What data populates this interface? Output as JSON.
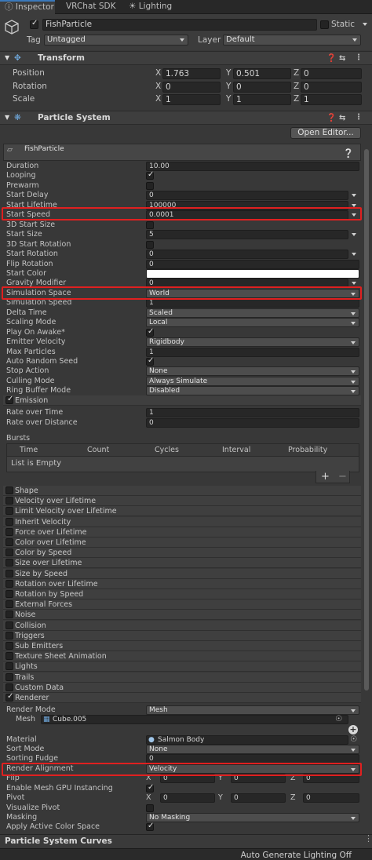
{
  "tabs": [
    {
      "label": "Inspector",
      "icon": "info-icon"
    },
    {
      "label": "VRChat SDK"
    },
    {
      "label": "Lighting",
      "icon": "lightbulb-icon"
    }
  ],
  "object": {
    "enabled": true,
    "name": "FishParticle",
    "static_label": "Static",
    "tag_label": "Tag",
    "tag": "Untagged",
    "layer_label": "Layer",
    "layer": "Default"
  },
  "transform": {
    "title": "Transform",
    "rows": [
      {
        "label": "Position",
        "x": "1.763",
        "y": "0.501",
        "z": "0"
      },
      {
        "label": "Rotation",
        "x": "0",
        "y": "0",
        "z": "0"
      },
      {
        "label": "Scale",
        "x": "1",
        "y": "1",
        "z": "1"
      }
    ]
  },
  "particle_system": {
    "title": "Particle System",
    "open_editor": "Open Editor...",
    "name": "FishParticle",
    "main_rows": [
      {
        "label": "Duration",
        "value": "10.00",
        "kind": "field"
      },
      {
        "label": "Looping",
        "value": "",
        "kind": "checkbox",
        "checked": true
      },
      {
        "label": "Prewarm",
        "value": "",
        "kind": "checkbox",
        "checked": false
      },
      {
        "label": "Start Delay",
        "value": "0",
        "kind": "field"
      },
      {
        "label": "Start Lifetime",
        "value": "100000",
        "kind": "field"
      },
      {
        "label": "Start Speed",
        "value": "0.0001",
        "kind": "field"
      },
      {
        "label": "3D Start Size",
        "value": "",
        "kind": "checkbox",
        "checked": false
      },
      {
        "label": "Start Size",
        "value": "5",
        "kind": "field"
      },
      {
        "label": "3D Start Rotation",
        "value": "",
        "kind": "checkbox",
        "checked": false
      },
      {
        "label": "Start Rotation",
        "value": "0",
        "kind": "field"
      },
      {
        "label": "Flip Rotation",
        "value": "0",
        "kind": "field"
      },
      {
        "label": "Start Color",
        "value": "",
        "kind": "color",
        "color": "#ffffff"
      },
      {
        "label": "Gravity Modifier",
        "value": "0",
        "kind": "field"
      },
      {
        "label": "Simulation Space",
        "value": "World",
        "kind": "drop"
      },
      {
        "label": "Simulation Speed",
        "value": "1",
        "kind": "field"
      },
      {
        "label": "Delta Time",
        "value": "Scaled",
        "kind": "drop"
      },
      {
        "label": "Scaling Mode",
        "value": "Local",
        "kind": "drop"
      },
      {
        "label": "Play On Awake*",
        "value": "",
        "kind": "checkbox",
        "checked": true
      },
      {
        "label": "Emitter Velocity",
        "value": "Rigidbody",
        "kind": "drop"
      },
      {
        "label": "Max Particles",
        "value": "1",
        "kind": "field"
      },
      {
        "label": "Auto Random Seed",
        "value": "",
        "kind": "checkbox",
        "checked": true
      },
      {
        "label": "Stop Action",
        "value": "None",
        "kind": "drop"
      },
      {
        "label": "Culling Mode",
        "value": "Always Simulate",
        "kind": "drop"
      },
      {
        "label": "Ring Buffer Mode",
        "value": "Disabled",
        "kind": "drop"
      }
    ],
    "emission": {
      "title": "Emission",
      "rate_time_label": "Rate over Time",
      "rate_time": "1",
      "rate_distance_label": "Rate over Distance",
      "rate_distance": "0",
      "bursts_label": "Bursts",
      "columns": [
        "Time",
        "Count",
        "Cycles",
        "Interval",
        "Probability"
      ],
      "empty": "List is Empty",
      "add": "+",
      "remove": "−"
    },
    "modules": [
      {
        "label": "Shape",
        "checked": false
      },
      {
        "label": "Velocity over Lifetime",
        "checked": false
      },
      {
        "label": "Limit Velocity over Lifetime",
        "checked": false
      },
      {
        "label": "Inherit Velocity",
        "checked": false
      },
      {
        "label": "Force over Lifetime",
        "checked": false
      },
      {
        "label": "Color over Lifetime",
        "checked": false
      },
      {
        "label": "Color by Speed",
        "checked": false
      },
      {
        "label": "Size over Lifetime",
        "checked": false
      },
      {
        "label": "Size by Speed",
        "checked": false
      },
      {
        "label": "Rotation over Lifetime",
        "checked": false
      },
      {
        "label": "Rotation by Speed",
        "checked": false
      },
      {
        "label": "External Forces",
        "checked": false
      },
      {
        "label": "Noise",
        "checked": false
      },
      {
        "label": "Collision",
        "checked": false
      },
      {
        "label": "Triggers",
        "checked": false
      },
      {
        "label": "Sub Emitters",
        "checked": false
      },
      {
        "label": "Texture Sheet Animation",
        "checked": false
      },
      {
        "label": "Lights",
        "checked": false
      },
      {
        "label": "Trails",
        "checked": false
      },
      {
        "label": "Custom Data",
        "checked": false
      }
    ],
    "renderer": {
      "title": "Renderer",
      "render_mode_label": "Render Mode",
      "render_mode": "Mesh",
      "mesh_label": "Mesh",
      "mesh": "Cube.005",
      "material_label": "Material",
      "material": "Salmon Body",
      "sort_mode_label": "Sort Mode",
      "sort_mode": "None",
      "sorting_fudge_label": "Sorting Fudge",
      "sorting_fudge": "0",
      "render_alignment_label": "Render Alignment",
      "render_alignment": "Velocity",
      "flip_label": "Flip",
      "flip": {
        "x": "0",
        "y": "0",
        "z": "0"
      },
      "gpu_label": "Enable Mesh GPU Instancing",
      "pivot_label": "Pivot",
      "pivot": {
        "x": "0",
        "y": "0",
        "z": "0"
      },
      "visualize_pivot_label": "Visualize Pivot",
      "masking_label": "Masking",
      "masking": "No Masking",
      "apply_color_label": "Apply Active Color Space"
    }
  },
  "curves_title": "Particle System Curves",
  "footer": "Auto Generate Lighting Off",
  "colors": {
    "highlight": "#e02020",
    "accent": "#3a79bb"
  }
}
